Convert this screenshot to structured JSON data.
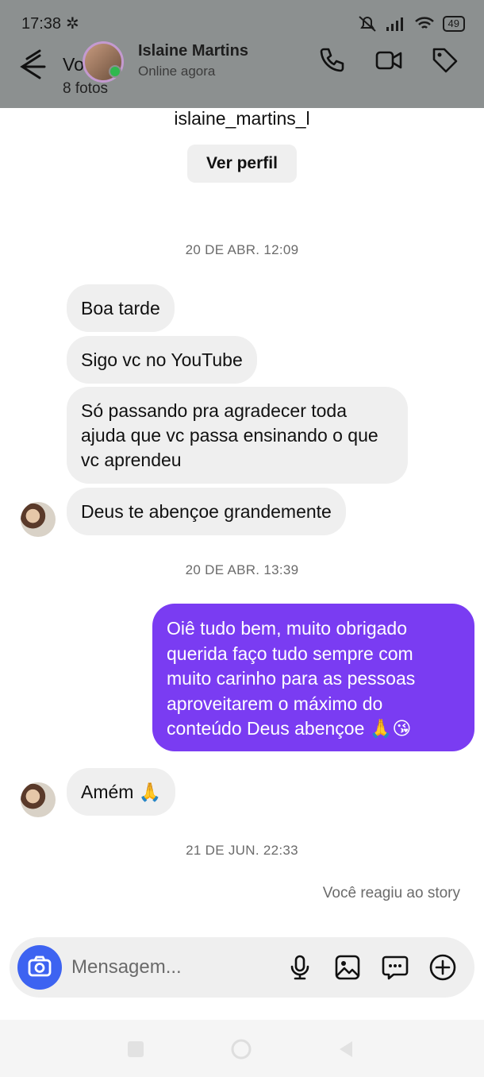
{
  "status_bar": {
    "time": "17:38",
    "battery": "49"
  },
  "header": {
    "back_label": "Você",
    "photos": "8 fotos",
    "contact_name": "Islaine Martins",
    "contact_status": "Online agora"
  },
  "profile": {
    "clipped_name": "Islaine Martins",
    "username": "islaine_martins_l",
    "view_profile": "Ver perfil"
  },
  "conversation": {
    "date1": "20 DE ABR. 12:09",
    "msg1": "Boa tarde",
    "msg2": "Sigo vc no YouTube",
    "msg3": "Só passando pra agradecer toda ajuda que vc passa ensinando o que vc aprendeu",
    "msg4": "Deus te abençoe grandemente",
    "date2": "20 DE ABR. 13:39",
    "reply": "Oiê tudo bem, muito obrigado querida faço tudo sempre com muito carinho para as pessoas aproveitarem o máximo do conteúdo Deus abençoe 🙏😘",
    "msg5": "Amém 🙏",
    "date3": "21 DE JUN. 22:33",
    "story_reaction": "Você reagiu ao story"
  },
  "composer": {
    "placeholder": "Mensagem..."
  },
  "colors": {
    "accent": "#7a3cf2",
    "camera": "#3d63f1",
    "online": "#2fb84e"
  }
}
